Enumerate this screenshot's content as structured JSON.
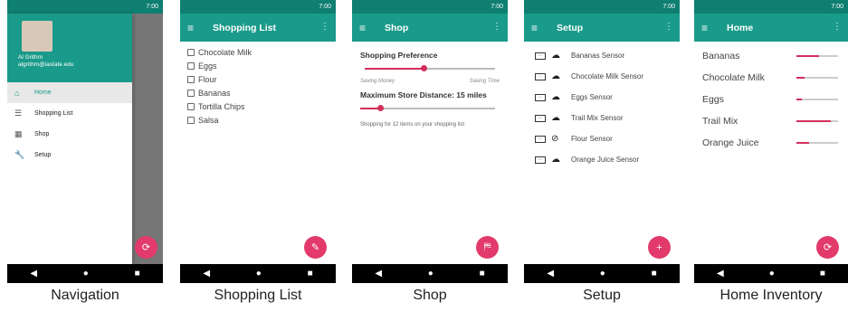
{
  "status": {
    "time": "7:00"
  },
  "nav": {
    "user_name": "Al Grithm",
    "user_email": "algrithm@iastate.edu",
    "items": [
      {
        "label": "Home",
        "icon": "home-icon",
        "active": true
      },
      {
        "label": "Shopping List",
        "icon": "list-icon",
        "active": false
      },
      {
        "label": "Shop",
        "icon": "store-icon",
        "active": false
      },
      {
        "label": "Setup",
        "icon": "wrench-icon",
        "active": false
      }
    ],
    "caption": "Navigation"
  },
  "shopping_list": {
    "title": "Shopping List",
    "items": [
      "Chocolate Milk",
      "Eggs",
      "Flour",
      "Bananas",
      "Tortilla Chips",
      "Salsa"
    ],
    "caption": "Shopping List"
  },
  "shop": {
    "title": "Shop",
    "preference_title": "Shopping Preference",
    "preference_value": 0.45,
    "label_left": "Saving Money",
    "label_right": "Saving Time",
    "distance_title": "Maximum Store Distance: 15 miles",
    "distance_value": 0.15,
    "note": "Shopping for 12 items on your shopping list",
    "caption": "Shop"
  },
  "setup": {
    "title": "Setup",
    "sensors": [
      {
        "label": "Bananas Sensor",
        "connected": true
      },
      {
        "label": "Chocolate Milk Sensor",
        "connected": true
      },
      {
        "label": "Eggs Sensor",
        "connected": true
      },
      {
        "label": "Trail Mix Sensor",
        "connected": true
      },
      {
        "label": "Flour Sensor",
        "connected": false
      },
      {
        "label": "Orange Juice Sensor",
        "connected": true
      }
    ],
    "caption": "Setup"
  },
  "home": {
    "title": "Home",
    "items": [
      {
        "label": "Bananas",
        "level": 0.55
      },
      {
        "label": "Chocolate Milk",
        "level": 0.2
      },
      {
        "label": "Eggs",
        "level": 0.12
      },
      {
        "label": "Trail Mix",
        "level": 0.82
      },
      {
        "label": "Orange Juice",
        "level": 0.3
      }
    ],
    "caption": "Home Inventory"
  },
  "colors": {
    "primary": "#1a9a8a",
    "primary_dark": "#0f7f71",
    "accent": "#e23a6a"
  }
}
